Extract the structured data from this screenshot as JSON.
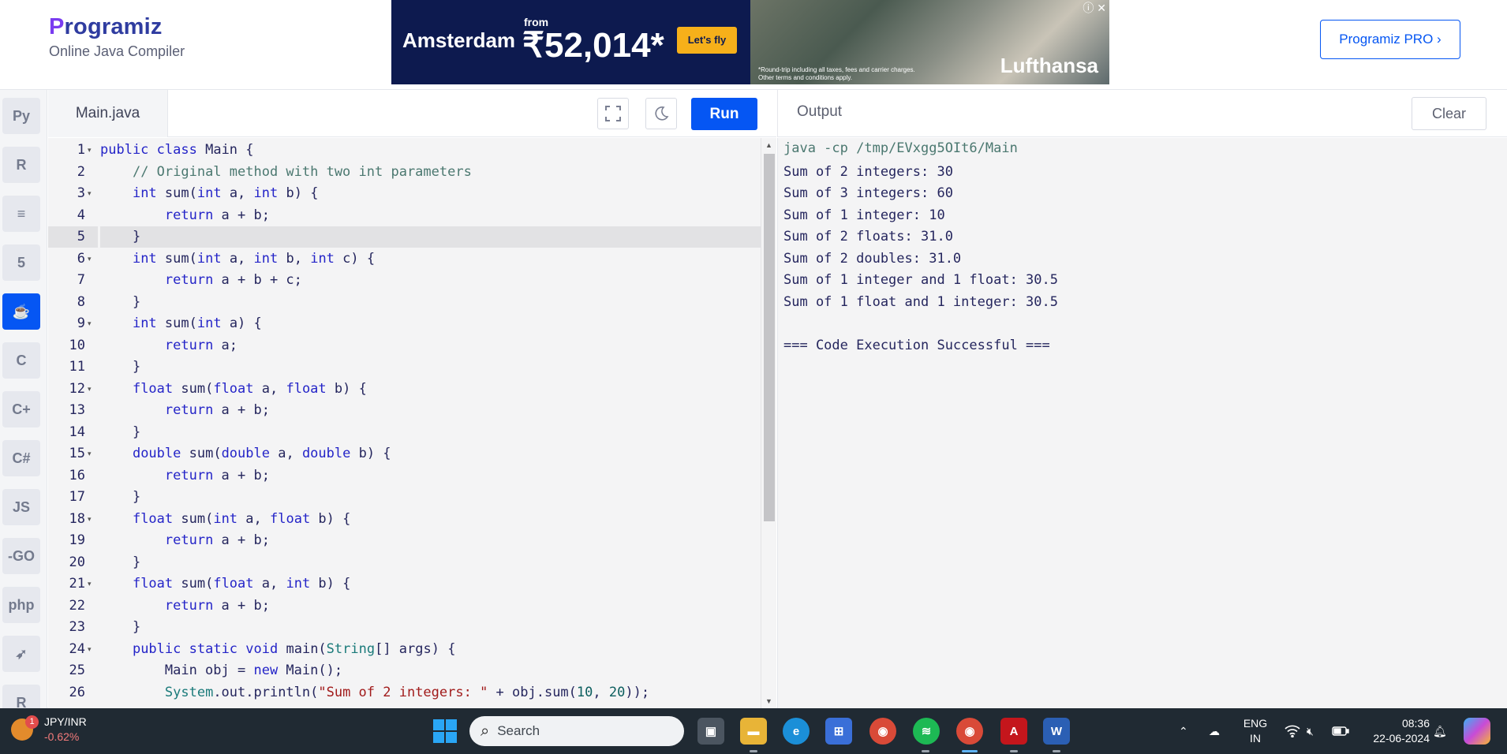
{
  "header": {
    "logo_text": "rogramiz",
    "logo_initial": "P",
    "subtitle": "Online Java Compiler",
    "pro_button": "Programiz PRO ›"
  },
  "ad": {
    "city": "Amsterdam",
    "from": "from",
    "price": "₹52,014*",
    "cta": "Let's fly",
    "brand": "Lufthansa",
    "note": "*Round-trip including all taxes, fees and carrier charges. Other terms and conditions apply."
  },
  "sidebar": {
    "items": [
      {
        "name": "python",
        "label": "Py"
      },
      {
        "name": "r",
        "label": "R"
      },
      {
        "name": "sql",
        "label": "≡"
      },
      {
        "name": "html",
        "label": "5"
      },
      {
        "name": "java",
        "label": "☕"
      },
      {
        "name": "c",
        "label": "C"
      },
      {
        "name": "cpp",
        "label": "C+"
      },
      {
        "name": "csharp",
        "label": "C#"
      },
      {
        "name": "js",
        "label": "JS"
      },
      {
        "name": "go",
        "label": "-GO"
      },
      {
        "name": "php",
        "label": "php"
      },
      {
        "name": "swift",
        "label": "➶"
      },
      {
        "name": "rust",
        "label": "R"
      }
    ]
  },
  "editor": {
    "file_tab": "Main.java",
    "run_label": "Run",
    "active_line": 5,
    "lines": [
      {
        "n": "1",
        "fold": true,
        "html": "<span class=\"kw\">public</span> <span class=\"kw\">class</span> Main {"
      },
      {
        "n": "2",
        "fold": false,
        "html": "    <span class=\"cm\">// Original method with two int parameters</span>"
      },
      {
        "n": "3",
        "fold": true,
        "html": "    <span class=\"kw\">int</span> sum(<span class=\"kw\">int</span> a, <span class=\"kw\">int</span> b) {"
      },
      {
        "n": "4",
        "fold": false,
        "html": "        <span class=\"kw\">return</span> a + b;"
      },
      {
        "n": "5",
        "fold": false,
        "html": "    }"
      },
      {
        "n": "6",
        "fold": true,
        "html": "    <span class=\"kw\">int</span> sum(<span class=\"kw\">int</span> a, <span class=\"kw\">int</span> b, <span class=\"kw\">int</span> c) {"
      },
      {
        "n": "7",
        "fold": false,
        "html": "        <span class=\"kw\">return</span> a + b + c;"
      },
      {
        "n": "8",
        "fold": false,
        "html": "    }"
      },
      {
        "n": "9",
        "fold": true,
        "html": "    <span class=\"kw\">int</span> sum(<span class=\"kw\">int</span> a) {"
      },
      {
        "n": "10",
        "fold": false,
        "html": "        <span class=\"kw\">return</span> a;"
      },
      {
        "n": "11",
        "fold": false,
        "html": "    }"
      },
      {
        "n": "12",
        "fold": true,
        "html": "    <span class=\"kw\">float</span> sum(<span class=\"kw\">float</span> a, <span class=\"kw\">float</span> b) {"
      },
      {
        "n": "13",
        "fold": false,
        "html": "        <span class=\"kw\">return</span> a + b;"
      },
      {
        "n": "14",
        "fold": false,
        "html": "    }"
      },
      {
        "n": "15",
        "fold": true,
        "html": "    <span class=\"kw\">double</span> sum(<span class=\"kw\">double</span> a, <span class=\"kw\">double</span> b) {"
      },
      {
        "n": "16",
        "fold": false,
        "html": "        <span class=\"kw\">return</span> a + b;"
      },
      {
        "n": "17",
        "fold": false,
        "html": "    }"
      },
      {
        "n": "18",
        "fold": true,
        "html": "    <span class=\"kw\">float</span> sum(<span class=\"kw\">int</span> a, <span class=\"kw\">float</span> b) {"
      },
      {
        "n": "19",
        "fold": false,
        "html": "        <span class=\"kw\">return</span> a + b;"
      },
      {
        "n": "20",
        "fold": false,
        "html": "    }"
      },
      {
        "n": "21",
        "fold": true,
        "html": "    <span class=\"kw\">float</span> sum(<span class=\"kw\">float</span> a, <span class=\"kw\">int</span> b) {"
      },
      {
        "n": "22",
        "fold": false,
        "html": "        <span class=\"kw\">return</span> a + b;"
      },
      {
        "n": "23",
        "fold": false,
        "html": "    }"
      },
      {
        "n": "24",
        "fold": true,
        "html": "    <span class=\"kw\">public</span> <span class=\"kw\">static</span> <span class=\"kw\">void</span> main(<span class=\"ty\">String</span>[] args) {"
      },
      {
        "n": "25",
        "fold": false,
        "html": "        Main obj = <span class=\"kw\">new</span> Main();"
      },
      {
        "n": "26",
        "fold": false,
        "html": "        <span class=\"ty\">System</span>.out.println(<span class=\"st\">\"Sum of 2 integers: \"</span> + obj.sum(<span class=\"nm\">10</span>, <span class=\"nm\">20</span>));"
      }
    ]
  },
  "output": {
    "title": "Output",
    "clear_label": "Clear",
    "command": "java -cp /tmp/EVxgg5OIt6/Main",
    "lines": [
      "Sum of 2 integers: 30",
      "Sum of 3 integers: 60",
      "Sum of 1 integer: 10",
      "Sum of 2 floats: 31.0",
      "Sum of 2 doubles: 31.0",
      "Sum of 1 integer and 1 float: 30.5",
      "Sum of 1 float and 1 integer: 30.5",
      "",
      "=== Code Execution Successful ==="
    ]
  },
  "taskbar": {
    "stock_symbol": "JPY/INR",
    "stock_change": "-0.62%",
    "notification_count": "1",
    "search_placeholder": "Search",
    "lang_top": "ENG",
    "lang_bottom": "IN",
    "time": "08:36",
    "date": "22-06-2024"
  }
}
